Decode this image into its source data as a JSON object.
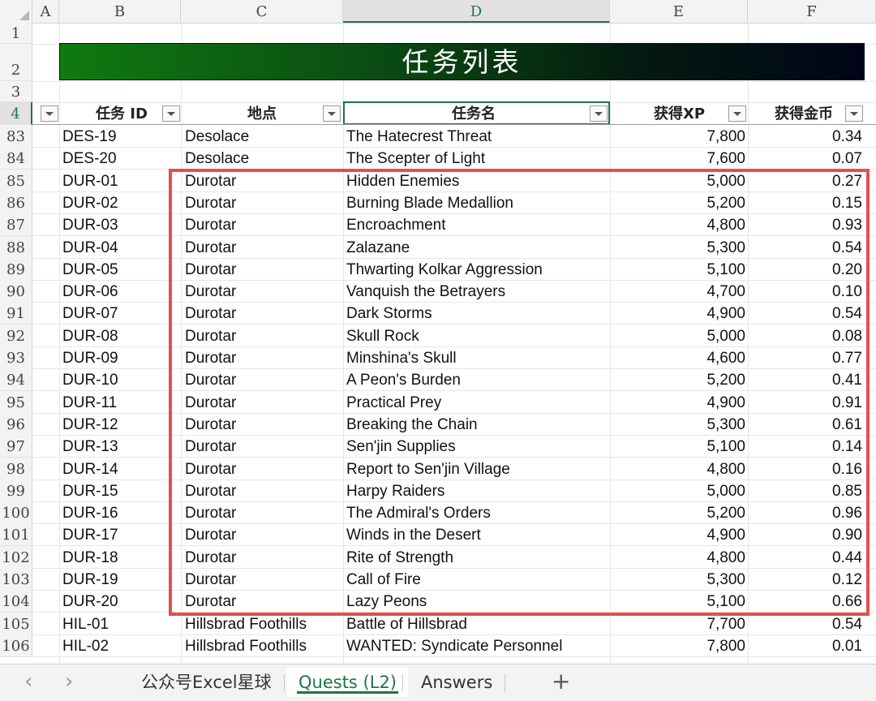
{
  "columns": [
    "A",
    "B",
    "C",
    "D",
    "E",
    "F"
  ],
  "top_rows": [
    "1",
    "2",
    "3",
    "4"
  ],
  "title": "任务列表",
  "headers": {
    "quest_id": "任务 ID",
    "location": "地点",
    "quest_name": "任务名",
    "xp": "获得XP",
    "gold": "获得金币"
  },
  "rows": [
    {
      "row": "83",
      "id": "DES-19",
      "loc": "Desolace",
      "name": "The Hatecrest Threat",
      "xp": "7,800",
      "gold": "0.34"
    },
    {
      "row": "84",
      "id": "DES-20",
      "loc": "Desolace",
      "name": "The Scepter of Light",
      "xp": "7,600",
      "gold": "0.07"
    },
    {
      "row": "85",
      "id": "DUR-01",
      "loc": "Durotar",
      "name": "Hidden Enemies",
      "xp": "5,000",
      "gold": "0.27"
    },
    {
      "row": "86",
      "id": "DUR-02",
      "loc": "Durotar",
      "name": "Burning Blade Medallion",
      "xp": "5,200",
      "gold": "0.15"
    },
    {
      "row": "87",
      "id": "DUR-03",
      "loc": "Durotar",
      "name": "Encroachment",
      "xp": "4,800",
      "gold": "0.93"
    },
    {
      "row": "88",
      "id": "DUR-04",
      "loc": "Durotar",
      "name": "Zalazane",
      "xp": "5,300",
      "gold": "0.54"
    },
    {
      "row": "89",
      "id": "DUR-05",
      "loc": "Durotar",
      "name": "Thwarting Kolkar Aggression",
      "xp": "5,100",
      "gold": "0.20"
    },
    {
      "row": "90",
      "id": "DUR-06",
      "loc": "Durotar",
      "name": "Vanquish the Betrayers",
      "xp": "4,700",
      "gold": "0.10"
    },
    {
      "row": "91",
      "id": "DUR-07",
      "loc": "Durotar",
      "name": "Dark Storms",
      "xp": "4,900",
      "gold": "0.54"
    },
    {
      "row": "92",
      "id": "DUR-08",
      "loc": "Durotar",
      "name": "Skull Rock",
      "xp": "5,000",
      "gold": "0.08"
    },
    {
      "row": "93",
      "id": "DUR-09",
      "loc": "Durotar",
      "name": "Minshina's Skull",
      "xp": "4,600",
      "gold": "0.77"
    },
    {
      "row": "94",
      "id": "DUR-10",
      "loc": "Durotar",
      "name": "A Peon's Burden",
      "xp": "5,200",
      "gold": "0.41"
    },
    {
      "row": "95",
      "id": "DUR-11",
      "loc": "Durotar",
      "name": "Practical Prey",
      "xp": "4,900",
      "gold": "0.91"
    },
    {
      "row": "96",
      "id": "DUR-12",
      "loc": "Durotar",
      "name": "Breaking the Chain",
      "xp": "5,300",
      "gold": "0.61"
    },
    {
      "row": "97",
      "id": "DUR-13",
      "loc": "Durotar",
      "name": "Sen'jin Supplies",
      "xp": "5,100",
      "gold": "0.14"
    },
    {
      "row": "98",
      "id": "DUR-14",
      "loc": "Durotar",
      "name": "Report to Sen'jin Village",
      "xp": "4,800",
      "gold": "0.16"
    },
    {
      "row": "99",
      "id": "DUR-15",
      "loc": "Durotar",
      "name": "Harpy Raiders",
      "xp": "5,000",
      "gold": "0.85"
    },
    {
      "row": "100",
      "id": "DUR-16",
      "loc": "Durotar",
      "name": "The Admiral's Orders",
      "xp": "5,200",
      "gold": "0.96"
    },
    {
      "row": "101",
      "id": "DUR-17",
      "loc": "Durotar",
      "name": "Winds in the Desert",
      "xp": "4,900",
      "gold": "0.90"
    },
    {
      "row": "102",
      "id": "DUR-18",
      "loc": "Durotar",
      "name": "Rite of Strength",
      "xp": "4,800",
      "gold": "0.44"
    },
    {
      "row": "103",
      "id": "DUR-19",
      "loc": "Durotar",
      "name": "Call of Fire",
      "xp": "5,300",
      "gold": "0.12"
    },
    {
      "row": "104",
      "id": "DUR-20",
      "loc": "Durotar",
      "name": "Lazy Peons",
      "xp": "5,100",
      "gold": "0.66"
    },
    {
      "row": "105",
      "id": "HIL-01",
      "loc": "Hillsbrad Foothills",
      "name": "Battle of Hillsbrad",
      "xp": "7,700",
      "gold": "0.54"
    },
    {
      "row": "106",
      "id": "HIL-02",
      "loc": "Hillsbrad Foothills",
      "name": "WANTED: Syndicate Personnel",
      "xp": "7,800",
      "gold": "0.01"
    }
  ],
  "tabs": [
    "公众号Excel星球",
    "Quests (L2)",
    "Answers"
  ],
  "active_tab": "Quests (L2)",
  "nav": {
    "prev": "‹",
    "next": "›",
    "add": "+"
  },
  "colors": {
    "accent": "#217346",
    "highlight_box": "#e05050",
    "title_start": "#0f7a0f",
    "title_end": "#000518"
  }
}
